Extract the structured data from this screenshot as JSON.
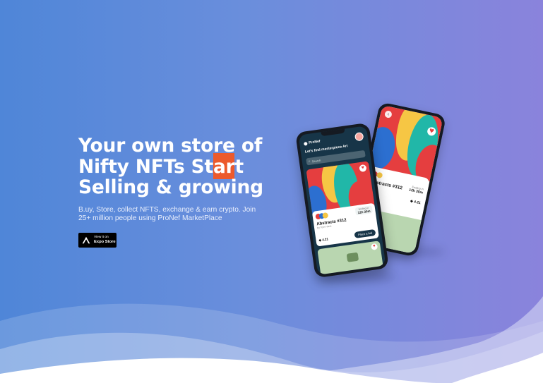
{
  "hero": {
    "title_lines": [
      "Your own store of",
      "Nifty NFTs Start",
      "Selling & growing"
    ],
    "subtitle_lines": [
      "B.uy, Store, collect NFTS, exchange & earn crypto. Join",
      "25+ million people using ProNef MarketPlace"
    ]
  },
  "store_button": {
    "small": "View it on",
    "big": "Expo Store"
  },
  "phone_front": {
    "app_name": "ProNef",
    "greeting": "Let's find masterpiece Art",
    "search_placeholder": "Search",
    "card_title": "Abstracts #312",
    "card_by": "by Tom Hans",
    "ending_label": "Ending in",
    "ending_time": "12h 30m",
    "price": "4.21",
    "bid_button": "Place a bid"
  },
  "phone_back": {
    "card_title": "Abstracts #312",
    "ending_label": "Ending in",
    "ending_time": "12h 30m",
    "price": "4.21"
  },
  "colors": {
    "bg_left": "#4f86d8",
    "bg_right": "#8a83dc",
    "accent_orange": "#ec5a2c",
    "phone_screen": "#173548"
  }
}
